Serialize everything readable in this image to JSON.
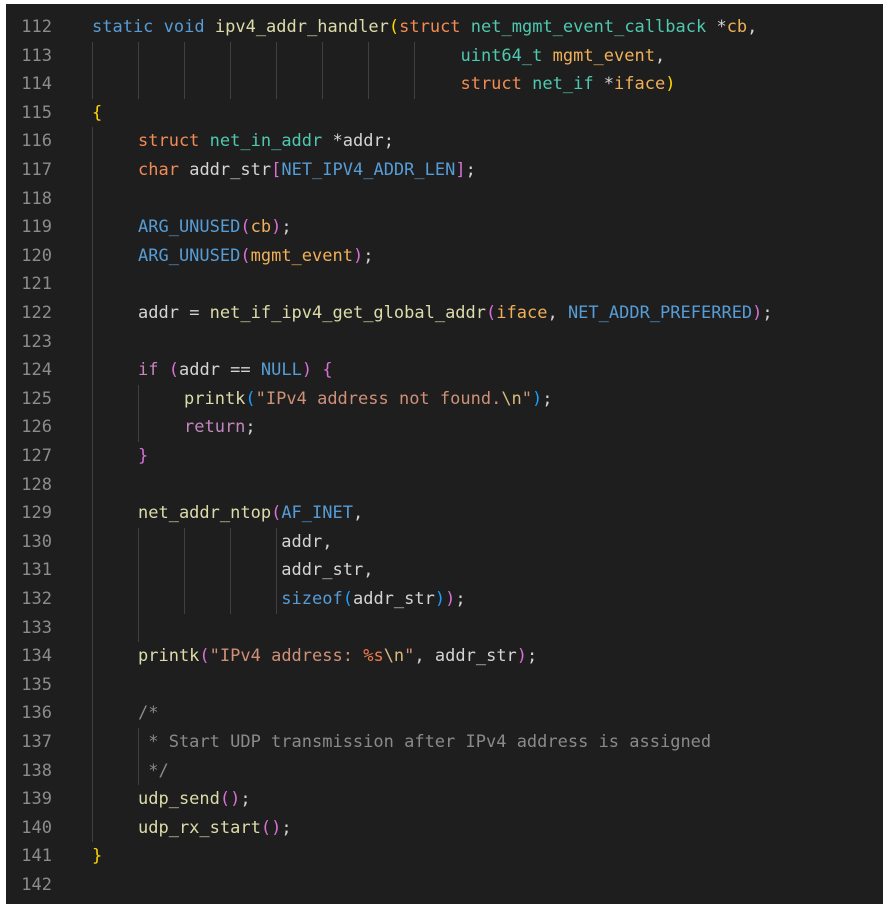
{
  "editor": {
    "lines": [
      {
        "num": "112",
        "indent": 0,
        "tokens": [
          {
            "t": "static",
            "c": "kw"
          },
          {
            "t": " ",
            "c": "pun"
          },
          {
            "t": "void",
            "c": "kw"
          },
          {
            "t": " ",
            "c": "pun"
          },
          {
            "t": "ipv4_addr_handler",
            "c": "fn"
          },
          {
            "t": "(",
            "c": "b1"
          },
          {
            "t": "struct",
            "c": "st"
          },
          {
            "t": " ",
            "c": "pun"
          },
          {
            "t": "net_mgmt_event_callback",
            "c": "ty"
          },
          {
            "t": " *",
            "c": "pun"
          },
          {
            "t": "cb",
            "c": "prm"
          },
          {
            "t": ",",
            "c": "pun"
          }
        ]
      },
      {
        "num": "113",
        "indent": 0,
        "tokens": [
          {
            "t": "                                    ",
            "c": "pun"
          },
          {
            "t": "uint64_t",
            "c": "ty"
          },
          {
            "t": " ",
            "c": "pun"
          },
          {
            "t": "mgmt_event",
            "c": "prm"
          },
          {
            "t": ",",
            "c": "pun"
          }
        ]
      },
      {
        "num": "114",
        "indent": 0,
        "tokens": [
          {
            "t": "                                    ",
            "c": "pun"
          },
          {
            "t": "struct",
            "c": "st"
          },
          {
            "t": " ",
            "c": "pun"
          },
          {
            "t": "net_if",
            "c": "ty"
          },
          {
            "t": " *",
            "c": "pun"
          },
          {
            "t": "iface",
            "c": "prm"
          },
          {
            "t": ")",
            "c": "b1"
          }
        ]
      },
      {
        "num": "115",
        "indent": 0,
        "tokens": [
          {
            "t": "{",
            "c": "b1"
          }
        ]
      },
      {
        "num": "116",
        "indent": 1,
        "tokens": [
          {
            "t": "struct",
            "c": "st"
          },
          {
            "t": " ",
            "c": "pun"
          },
          {
            "t": "net_in_addr",
            "c": "ty"
          },
          {
            "t": " *",
            "c": "pun"
          },
          {
            "t": "addr",
            "c": "pun"
          },
          {
            "t": ";",
            "c": "pun"
          }
        ]
      },
      {
        "num": "117",
        "indent": 1,
        "tokens": [
          {
            "t": "char",
            "c": "st"
          },
          {
            "t": " ",
            "c": "pun"
          },
          {
            "t": "addr_str",
            "c": "pun"
          },
          {
            "t": "[",
            "c": "b2"
          },
          {
            "t": "NET_IPV4_ADDR_LEN",
            "c": "mac"
          },
          {
            "t": "]",
            "c": "b2"
          },
          {
            "t": ";",
            "c": "pun"
          }
        ]
      },
      {
        "num": "118",
        "indent": 1,
        "tokens": []
      },
      {
        "num": "119",
        "indent": 1,
        "tokens": [
          {
            "t": "ARG_UNUSED",
            "c": "mac"
          },
          {
            "t": "(",
            "c": "b2"
          },
          {
            "t": "cb",
            "c": "prm"
          },
          {
            "t": ")",
            "c": "b2"
          },
          {
            "t": ";",
            "c": "pun"
          }
        ]
      },
      {
        "num": "120",
        "indent": 1,
        "tokens": [
          {
            "t": "ARG_UNUSED",
            "c": "mac"
          },
          {
            "t": "(",
            "c": "b2"
          },
          {
            "t": "mgmt_event",
            "c": "prm"
          },
          {
            "t": ")",
            "c": "b2"
          },
          {
            "t": ";",
            "c": "pun"
          }
        ]
      },
      {
        "num": "121",
        "indent": 1,
        "tokens": []
      },
      {
        "num": "122",
        "indent": 1,
        "tokens": [
          {
            "t": "addr",
            "c": "pun"
          },
          {
            "t": " = ",
            "c": "pun"
          },
          {
            "t": "net_if_ipv4_get_global_addr",
            "c": "fn"
          },
          {
            "t": "(",
            "c": "b2"
          },
          {
            "t": "iface",
            "c": "prm"
          },
          {
            "t": ", ",
            "c": "pun"
          },
          {
            "t": "NET_ADDR_PREFERRED",
            "c": "mac"
          },
          {
            "t": ")",
            "c": "b2"
          },
          {
            "t": ";",
            "c": "pun"
          }
        ]
      },
      {
        "num": "123",
        "indent": 1,
        "tokens": []
      },
      {
        "num": "124",
        "indent": 1,
        "tokens": [
          {
            "t": "if",
            "c": "ctl"
          },
          {
            "t": " ",
            "c": "pun"
          },
          {
            "t": "(",
            "c": "b2"
          },
          {
            "t": "addr",
            "c": "pun"
          },
          {
            "t": " == ",
            "c": "pun"
          },
          {
            "t": "NULL",
            "c": "mac"
          },
          {
            "t": ")",
            "c": "b2"
          },
          {
            "t": " ",
            "c": "pun"
          },
          {
            "t": "{",
            "c": "b2"
          }
        ]
      },
      {
        "num": "125",
        "indent": 2,
        "tokens": [
          {
            "t": "printk",
            "c": "fn"
          },
          {
            "t": "(",
            "c": "b3"
          },
          {
            "t": "\"IPv4 address not found.",
            "c": "str"
          },
          {
            "t": "\\n",
            "c": "esc"
          },
          {
            "t": "\"",
            "c": "str"
          },
          {
            "t": ")",
            "c": "b3"
          },
          {
            "t": ";",
            "c": "pun"
          }
        ]
      },
      {
        "num": "126",
        "indent": 2,
        "tokens": [
          {
            "t": "return",
            "c": "ctl"
          },
          {
            "t": ";",
            "c": "pun"
          }
        ]
      },
      {
        "num": "127",
        "indent": 1,
        "tokens": [
          {
            "t": "}",
            "c": "b2"
          }
        ]
      },
      {
        "num": "128",
        "indent": 1,
        "tokens": []
      },
      {
        "num": "129",
        "indent": 1,
        "tokens": [
          {
            "t": "net_addr_ntop",
            "c": "fn"
          },
          {
            "t": "(",
            "c": "b2"
          },
          {
            "t": "AF_INET",
            "c": "mac"
          },
          {
            "t": ",",
            "c": "pun"
          }
        ]
      },
      {
        "num": "130",
        "indent": 1,
        "tokens": [
          {
            "t": "              ",
            "c": "pun"
          },
          {
            "t": "addr",
            "c": "pun"
          },
          {
            "t": ",",
            "c": "pun"
          }
        ]
      },
      {
        "num": "131",
        "indent": 1,
        "tokens": [
          {
            "t": "              ",
            "c": "pun"
          },
          {
            "t": "addr_str",
            "c": "pun"
          },
          {
            "t": ",",
            "c": "pun"
          }
        ]
      },
      {
        "num": "132",
        "indent": 1,
        "tokens": [
          {
            "t": "              ",
            "c": "pun"
          },
          {
            "t": "sizeof",
            "c": "mac"
          },
          {
            "t": "(",
            "c": "b3"
          },
          {
            "t": "addr_str",
            "c": "pun"
          },
          {
            "t": ")",
            "c": "b3"
          },
          {
            "t": ")",
            "c": "b2"
          },
          {
            "t": ";",
            "c": "pun"
          }
        ]
      },
      {
        "num": "133",
        "indent": 1,
        "tokens": []
      },
      {
        "num": "134",
        "indent": 1,
        "tokens": [
          {
            "t": "printk",
            "c": "fn"
          },
          {
            "t": "(",
            "c": "b2"
          },
          {
            "t": "\"IPv4 address: ",
            "c": "str"
          },
          {
            "t": "%s",
            "c": "fmt"
          },
          {
            "t": "\\n",
            "c": "esc"
          },
          {
            "t": "\"",
            "c": "str"
          },
          {
            "t": ", ",
            "c": "pun"
          },
          {
            "t": "addr_str",
            "c": "pun"
          },
          {
            "t": ")",
            "c": "b2"
          },
          {
            "t": ";",
            "c": "pun"
          }
        ]
      },
      {
        "num": "135",
        "indent": 1,
        "tokens": []
      },
      {
        "num": "136",
        "indent": 1,
        "tokens": [
          {
            "t": "/*",
            "c": "cmt"
          }
        ]
      },
      {
        "num": "137",
        "indent": 1,
        "tokens": [
          {
            "t": " * Start UDP transmission after IPv4 address is assigned",
            "c": "cmt"
          }
        ]
      },
      {
        "num": "138",
        "indent": 1,
        "tokens": [
          {
            "t": " */",
            "c": "cmt"
          }
        ]
      },
      {
        "num": "139",
        "indent": 1,
        "tokens": [
          {
            "t": "udp_send",
            "c": "fn"
          },
          {
            "t": "()",
            "c": "b2"
          },
          {
            "t": ";",
            "c": "pun"
          }
        ]
      },
      {
        "num": "140",
        "indent": 1,
        "tokens": [
          {
            "t": "udp_rx_start",
            "c": "fn"
          },
          {
            "t": "()",
            "c": "b2"
          },
          {
            "t": ";",
            "c": "pun"
          }
        ]
      },
      {
        "num": "141",
        "indent": 0,
        "tokens": [
          {
            "t": "}",
            "c": "b1"
          }
        ]
      },
      {
        "num": "142",
        "indent": 0,
        "tokens": []
      }
    ]
  }
}
